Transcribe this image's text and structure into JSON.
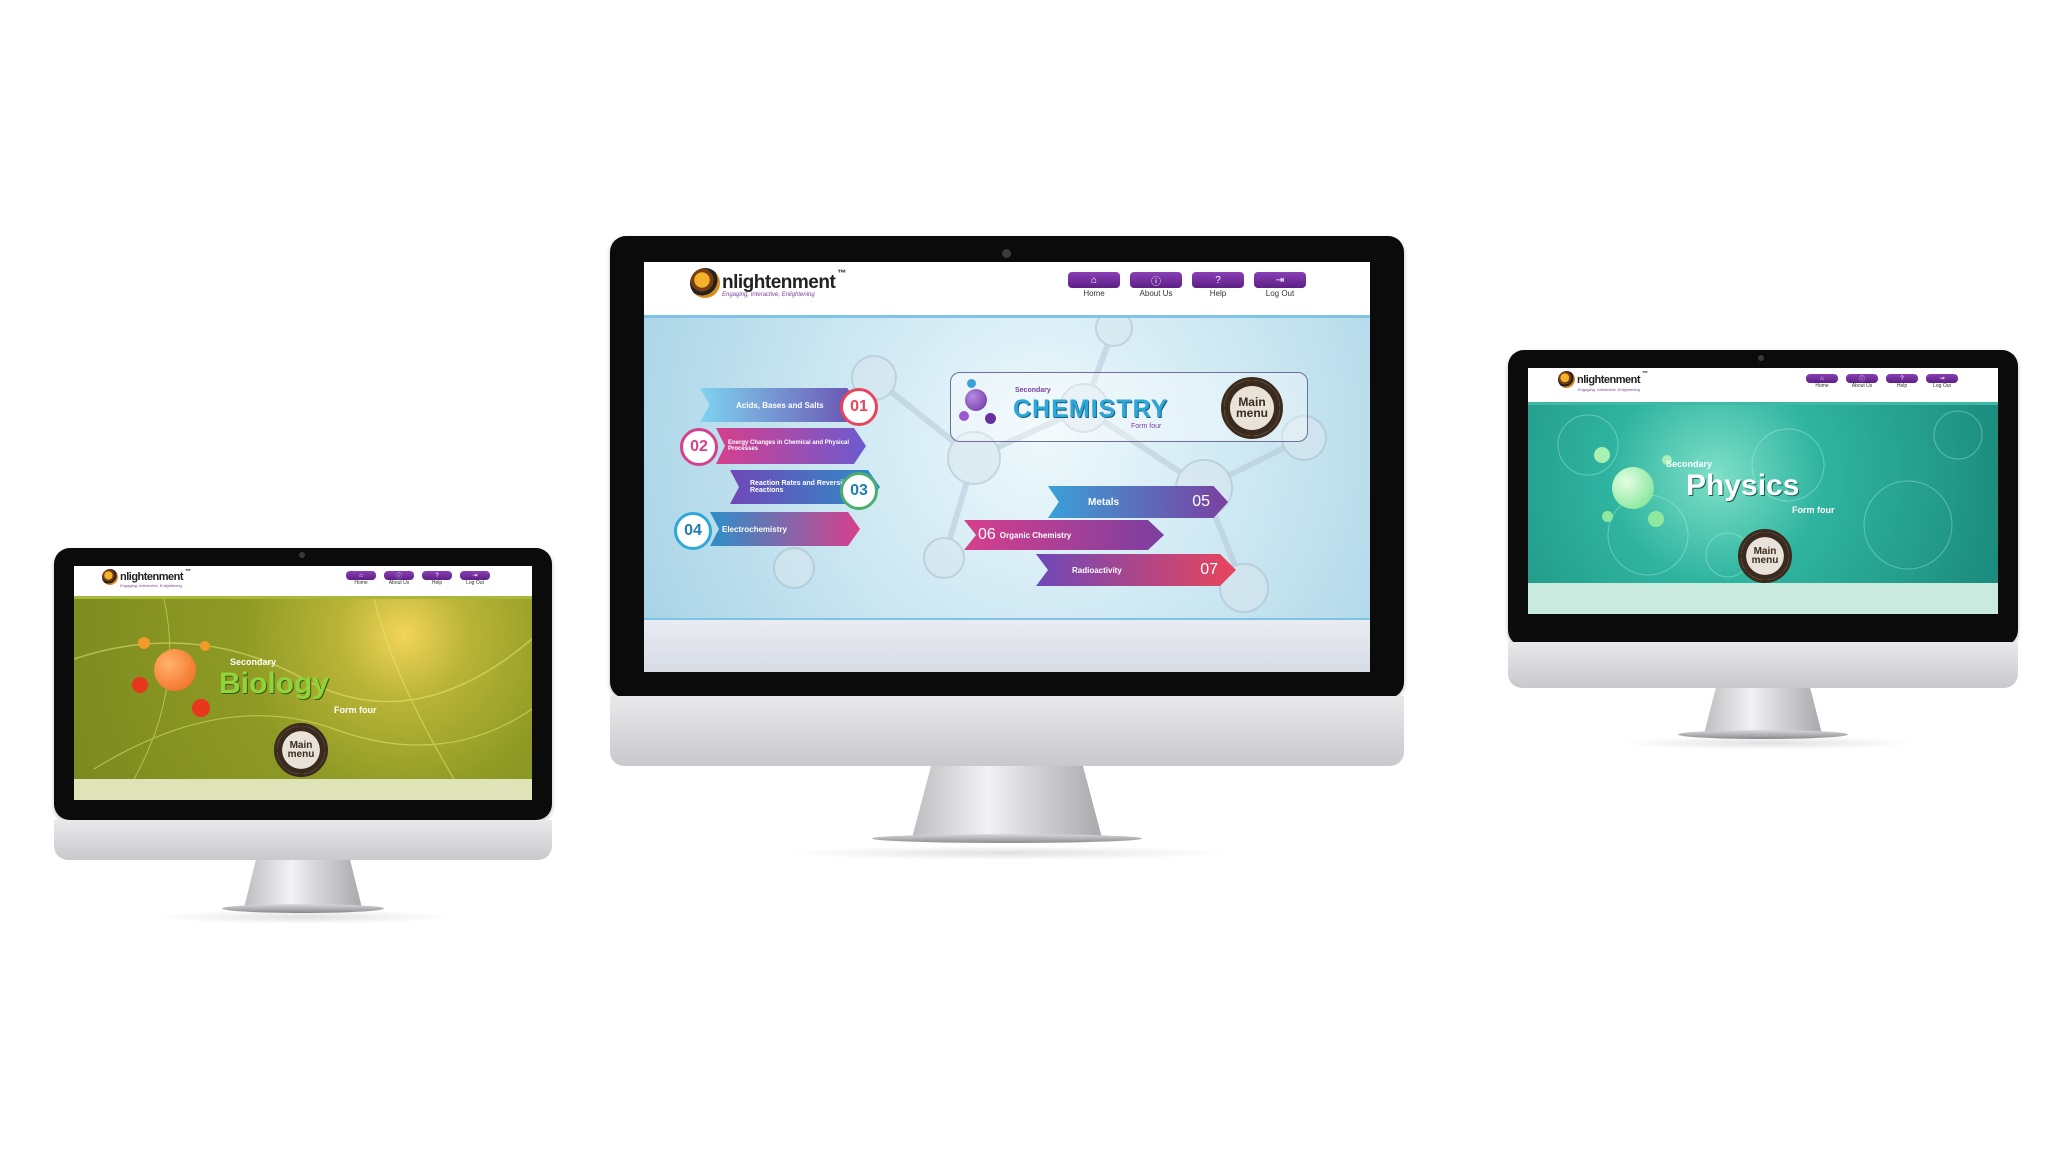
{
  "brand": {
    "name": "nlightenment",
    "initial": "e",
    "trademark": "™",
    "tagline": "Engaging, Interactive, Enlightening"
  },
  "nav": [
    {
      "label": "Home",
      "icon": "home-icon"
    },
    {
      "label": "About Us",
      "icon": "info-icon"
    },
    {
      "label": "Help",
      "icon": "help-icon"
    },
    {
      "label": "Log Out",
      "icon": "logout-icon"
    }
  ],
  "main_menu": {
    "line1": "Main",
    "line2": "menu"
  },
  "biology": {
    "prefix": "Secondary",
    "subject": "Biology",
    "level": "Form four",
    "colors": {
      "bg": "#9aa62a",
      "accent": "#f06a1c",
      "title": "#8ed43a"
    }
  },
  "chemistry": {
    "prefix": "Secondary",
    "subject": "CHEMISTRY",
    "level": "Form four",
    "topics": [
      {
        "num": "01",
        "label": "Acids, Bases and Salts"
      },
      {
        "num": "02",
        "label": "Energy Changes in Chemical and Physical Processes"
      },
      {
        "num": "03",
        "label": "Reaction Rates and Reversible Reactions"
      },
      {
        "num": "04",
        "label": "Electrochemistry"
      },
      {
        "num": "05",
        "label": "Metals"
      },
      {
        "num": "06",
        "label": "Organic Chemistry"
      },
      {
        "num": "07",
        "label": "Radioactivity"
      }
    ],
    "colors": {
      "bg": "#cfe9f3",
      "accent": "#7b3fa0",
      "title": "#2fa8d8"
    }
  },
  "physics": {
    "prefix": "Secondary",
    "subject": "Physics",
    "level": "Form four",
    "colors": {
      "bg": "#2fb4a0",
      "accent": "#8ff0a8",
      "title": "#ffffff"
    }
  }
}
